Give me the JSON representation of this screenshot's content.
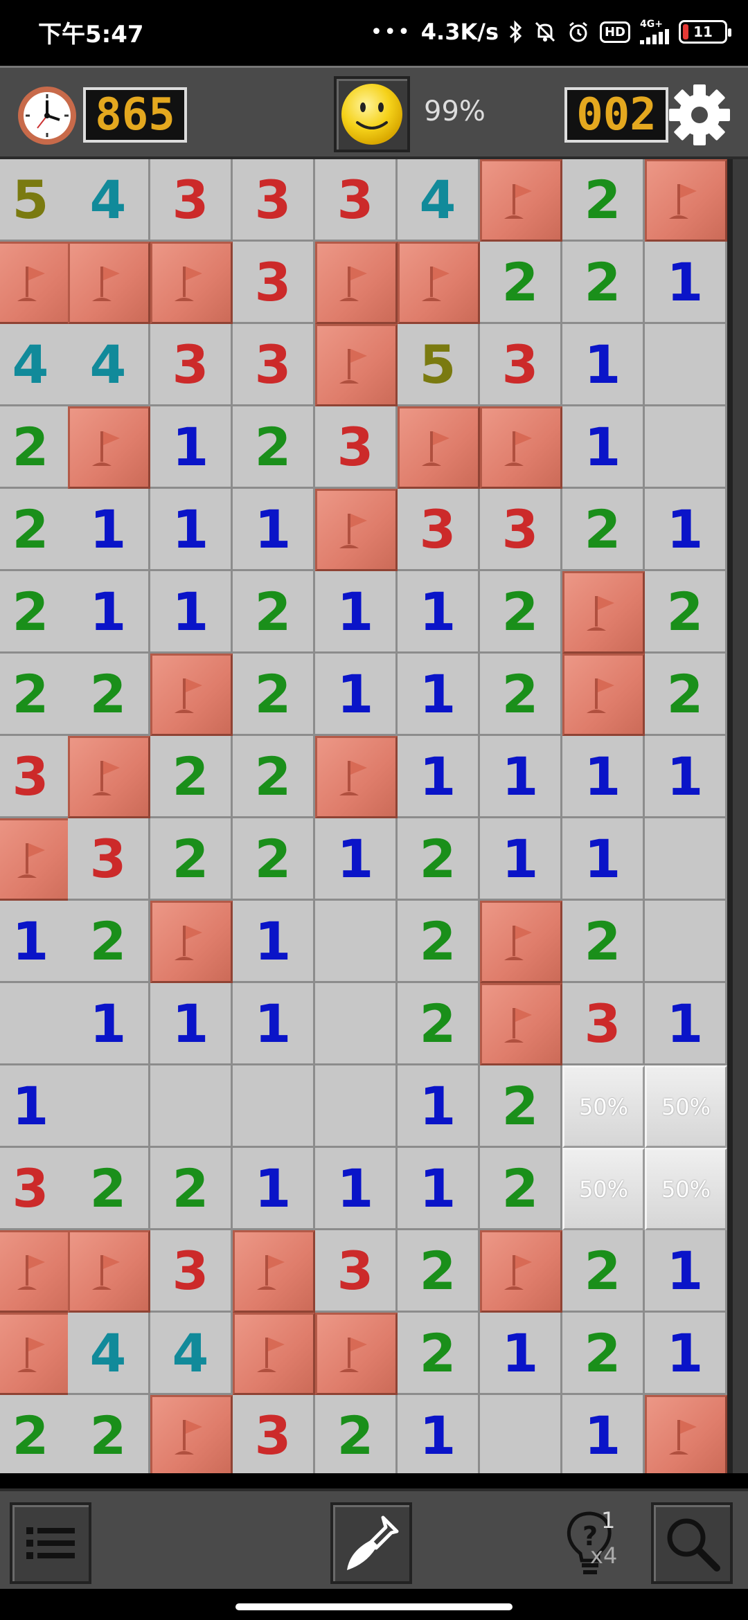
{
  "status_bar": {
    "time": "下午5:47",
    "net_speed": "4.3K/s",
    "network_label": "4G+",
    "battery": "11"
  },
  "header": {
    "timer": "865",
    "mines_left": "002",
    "progress": "99%"
  },
  "board": {
    "rows": [
      [
        "5",
        "4",
        "3",
        "3",
        "3",
        "4",
        "F",
        "2",
        "F"
      ],
      [
        "F",
        "F",
        "F",
        "3",
        "F",
        "F",
        "2",
        "2",
        "1"
      ],
      [
        "4",
        "4",
        "3",
        "3",
        "F",
        "5",
        "3",
        "1",
        ""
      ],
      [
        "2",
        "F",
        "1",
        "2",
        "3",
        "F",
        "F",
        "1",
        ""
      ],
      [
        "2",
        "1",
        "1",
        "1",
        "F",
        "3",
        "3",
        "2",
        "1"
      ],
      [
        "2",
        "1",
        "1",
        "2",
        "1",
        "1",
        "2",
        "F",
        "2"
      ],
      [
        "2",
        "2",
        "F",
        "2",
        "1",
        "1",
        "2",
        "F",
        "2"
      ],
      [
        "3",
        "F",
        "2",
        "2",
        "F",
        "1",
        "1",
        "1",
        "1"
      ],
      [
        "F",
        "3",
        "2",
        "2",
        "1",
        "2",
        "1",
        "1",
        ""
      ],
      [
        "1",
        "2",
        "F",
        "1",
        "",
        "2",
        "F",
        "2",
        ""
      ],
      [
        "",
        "1",
        "1",
        "1",
        "",
        "2",
        "F",
        "3",
        "1"
      ],
      [
        "1",
        "",
        "",
        "",
        "",
        "1",
        "2",
        "P",
        "P"
      ],
      [
        "3",
        "2",
        "2",
        "1",
        "1",
        "1",
        "2",
        "P",
        "P"
      ],
      [
        "F",
        "F",
        "3",
        "F",
        "3",
        "2",
        "F",
        "2",
        "1"
      ],
      [
        "F",
        "4",
        "4",
        "F",
        "F",
        "2",
        "1",
        "2",
        "1"
      ],
      [
        "2",
        "2",
        "F",
        "3",
        "2",
        "1",
        "",
        "1",
        "F"
      ]
    ],
    "probability_label": "50%",
    "number_colors": {
      "1": "#0a14c8",
      "2": "#1a8f1a",
      "3": "#cc2a2a",
      "4": "#118a9a",
      "5": "#7a7a10"
    }
  },
  "footer": {
    "hint_count": "1",
    "hint_multiplier": "x4"
  }
}
